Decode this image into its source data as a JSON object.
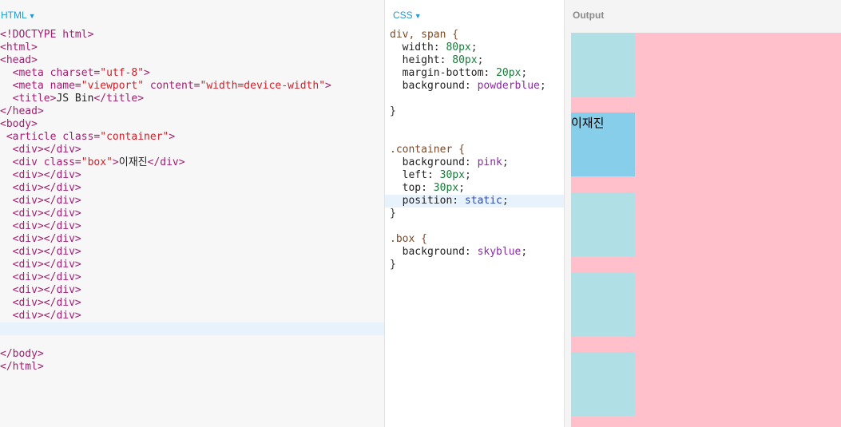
{
  "html_panel": {
    "label": "HTML"
  },
  "css_panel": {
    "label": "CSS"
  },
  "output_panel": {
    "label": "Output",
    "box_text": "이재진"
  },
  "html_lines": [
    [
      [
        "tag",
        "<!DOCTYPE html>"
      ]
    ],
    [
      [
        "tag",
        "<html>"
      ]
    ],
    [
      [
        "tag",
        "<head>"
      ]
    ],
    [
      [
        "txt",
        "  "
      ],
      [
        "tag",
        "<meta "
      ],
      [
        "attr",
        "charset="
      ],
      [
        "str",
        "\"utf-8\""
      ],
      [
        "tag",
        ">"
      ]
    ],
    [
      [
        "txt",
        "  "
      ],
      [
        "tag",
        "<meta "
      ],
      [
        "attr",
        "name="
      ],
      [
        "str",
        "\"viewport\""
      ],
      [
        "attr",
        " content="
      ],
      [
        "str",
        "\"width=device-width\""
      ],
      [
        "tag",
        ">"
      ]
    ],
    [
      [
        "txt",
        "  "
      ],
      [
        "tag",
        "<title>"
      ],
      [
        "txt",
        "JS Bin"
      ],
      [
        "tag",
        "</title>"
      ]
    ],
    [
      [
        "tag",
        "</head>"
      ]
    ],
    [
      [
        "tag",
        "<body>"
      ]
    ],
    [
      [
        "txt",
        " "
      ],
      [
        "tag",
        "<article "
      ],
      [
        "attr",
        "class="
      ],
      [
        "str",
        "\"container\""
      ],
      [
        "tag",
        ">"
      ]
    ],
    [
      [
        "txt",
        "  "
      ],
      [
        "tag",
        "<div></div>"
      ]
    ],
    [
      [
        "txt",
        "  "
      ],
      [
        "tag",
        "<div "
      ],
      [
        "attr",
        "class="
      ],
      [
        "str",
        "\"box\""
      ],
      [
        "tag",
        ">"
      ],
      [
        "txt",
        "이재진"
      ],
      [
        "tag",
        "</div>"
      ]
    ],
    [
      [
        "txt",
        "  "
      ],
      [
        "tag",
        "<div></div>"
      ]
    ],
    [
      [
        "txt",
        "  "
      ],
      [
        "tag",
        "<div></div>"
      ]
    ],
    [
      [
        "txt",
        "  "
      ],
      [
        "tag",
        "<div></div>"
      ]
    ],
    [
      [
        "txt",
        "  "
      ],
      [
        "tag",
        "<div></div>"
      ]
    ],
    [
      [
        "txt",
        "  "
      ],
      [
        "tag",
        "<div></div>"
      ]
    ],
    [
      [
        "txt",
        "  "
      ],
      [
        "tag",
        "<div></div>"
      ]
    ],
    [
      [
        "txt",
        "  "
      ],
      [
        "tag",
        "<div></div>"
      ]
    ],
    [
      [
        "txt",
        "  "
      ],
      [
        "tag",
        "<div></div>"
      ]
    ],
    [
      [
        "txt",
        "  "
      ],
      [
        "tag",
        "<div></div>"
      ]
    ],
    [
      [
        "txt",
        "  "
      ],
      [
        "tag",
        "<div></div>"
      ]
    ],
    [
      [
        "txt",
        "  "
      ],
      [
        "tag",
        "<div></div>"
      ]
    ],
    [
      [
        "txt",
        "  "
      ],
      [
        "tag",
        "<div></div>"
      ]
    ],
    [
      [
        "txt",
        ""
      ]
    ],
    [
      [
        "txt",
        ""
      ]
    ],
    [
      [
        "tag",
        "</body>"
      ]
    ],
    [
      [
        "tag",
        "</html>"
      ]
    ]
  ],
  "html_active_line": 23,
  "css_lines": [
    [
      [
        "sel",
        "div, span {"
      ]
    ],
    [
      [
        "prop",
        "  width: "
      ],
      [
        "val-num",
        "80px"
      ],
      [
        "punct",
        ";"
      ]
    ],
    [
      [
        "prop",
        "  height: "
      ],
      [
        "val-num",
        "80px"
      ],
      [
        "punct",
        ";"
      ]
    ],
    [
      [
        "prop",
        "  margin-bottom: "
      ],
      [
        "val-num",
        "20px"
      ],
      [
        "punct",
        ";"
      ]
    ],
    [
      [
        "prop",
        "  background: "
      ],
      [
        "val-kw",
        "powderblue"
      ],
      [
        "punct",
        ";"
      ]
    ],
    [
      [
        "punct",
        ""
      ]
    ],
    [
      [
        "punct",
        "}"
      ]
    ],
    [
      [
        "punct",
        ""
      ]
    ],
    [
      [
        "punct",
        ""
      ]
    ],
    [
      [
        "sel",
        ".container {"
      ]
    ],
    [
      [
        "prop",
        "  background: "
      ],
      [
        "val-kw",
        "pink"
      ],
      [
        "punct",
        ";"
      ]
    ],
    [
      [
        "prop",
        "  left: "
      ],
      [
        "val-num",
        "30px"
      ],
      [
        "punct",
        ";"
      ]
    ],
    [
      [
        "prop",
        "  top: "
      ],
      [
        "val-num",
        "30px"
      ],
      [
        "punct",
        ";"
      ]
    ],
    [
      [
        "prop",
        "  position: "
      ],
      [
        "val-stat",
        "static"
      ],
      [
        "punct",
        ";"
      ]
    ],
    [
      [
        "punct",
        "}"
      ]
    ],
    [
      [
        "punct",
        ""
      ]
    ],
    [
      [
        "sel",
        ".box {"
      ]
    ],
    [
      [
        "prop",
        "  background: "
      ],
      [
        "val-kw",
        "skyblue"
      ],
      [
        "punct",
        ";"
      ]
    ],
    [
      [
        "punct",
        "}"
      ]
    ]
  ],
  "css_active_line": 13,
  "output_boxes": [
    {
      "box": false
    },
    {
      "box": true
    },
    {
      "box": false
    },
    {
      "box": false
    },
    {
      "box": false
    }
  ],
  "colors": {
    "accent": "#1e9bd7",
    "container": "#ffc0cb",
    "div": "#b0e0e6",
    "box": "#87ceeb"
  }
}
